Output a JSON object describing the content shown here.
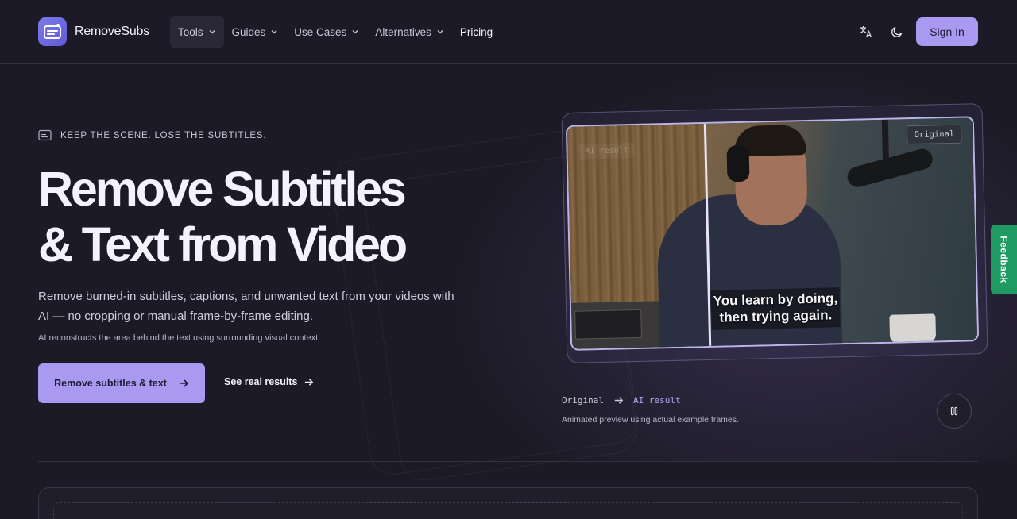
{
  "brand": {
    "name": "RemoveSubs"
  },
  "nav": {
    "items": [
      {
        "label": "Tools",
        "active": true
      },
      {
        "label": "Guides"
      },
      {
        "label": "Use Cases"
      },
      {
        "label": "Alternatives"
      }
    ],
    "pricing": "Pricing"
  },
  "header": {
    "translate_icon": "translate-icon",
    "theme_icon": "moon-icon",
    "signin_label": "Sign In"
  },
  "hero": {
    "eyebrow": "KEEP THE SCENE. LOSE THE SUBTITLES.",
    "headline_line1": "Remove Subtitles",
    "headline_line2": "& Text from Video",
    "lead": "Remove burned-in subtitles, captions, and unwanted text from your videos with AI — no cropping or manual frame-by-frame editing.",
    "sublead": "AI reconstructs the area behind the text using surrounding visual context.",
    "cta_primary": "Remove subtitles & text",
    "cta_secondary": "See real results"
  },
  "preview": {
    "tag_ai": "AI result",
    "tag_original": "Original",
    "subtitle_line1": "You learn by doing,",
    "subtitle_line2": "then trying again.",
    "legend_original": "Original",
    "legend_ai": "AI result",
    "caption": "Animated preview using actual example frames.",
    "pause_icon": "pause-icon"
  },
  "feedback": {
    "label": "Feedback"
  },
  "colors": {
    "accent": "#a999f0",
    "background": "#1c1a26",
    "feedback": "#1f9a62"
  }
}
